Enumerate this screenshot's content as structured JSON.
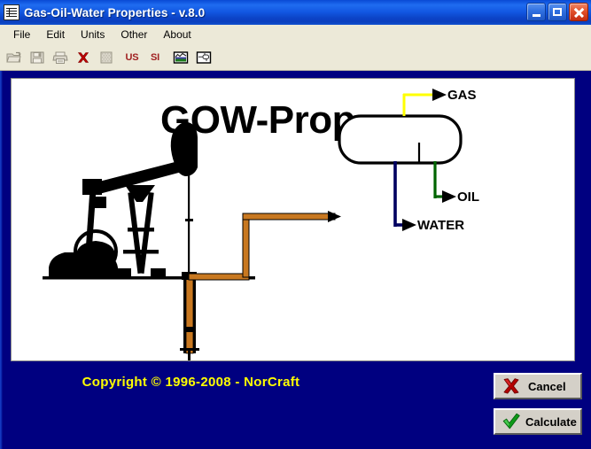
{
  "window": {
    "title": "Gas-Oil-Water Properties -  v.8.0",
    "icon": "document-lines-icon",
    "minimize_label": "",
    "maximize_label": "",
    "close_label": ""
  },
  "menu": {
    "items": [
      {
        "label": "File"
      },
      {
        "label": "Edit"
      },
      {
        "label": "Units"
      },
      {
        "label": "Other"
      },
      {
        "label": "About"
      }
    ]
  },
  "toolbar": {
    "buttons": [
      {
        "name": "open-button",
        "icon": "folder-open-icon",
        "label": ""
      },
      {
        "name": "save-button",
        "icon": "floppy-disk-icon",
        "label": ""
      },
      {
        "name": "print-button",
        "icon": "printer-icon",
        "label": ""
      },
      {
        "name": "delete-button",
        "icon": "red-x-icon",
        "label": ""
      },
      {
        "name": "new-button",
        "icon": "blank-page-icon",
        "label": ""
      },
      {
        "name": "us-units-button",
        "icon": "text-icon",
        "label": "US"
      },
      {
        "name": "si-units-button",
        "icon": "text-icon",
        "label": "SI"
      },
      {
        "name": "chart-button",
        "icon": "chart-image-icon",
        "label": ""
      },
      {
        "name": "diagram-button",
        "icon": "diagram-icon",
        "label": ""
      }
    ]
  },
  "main": {
    "app_title": "GOW-Prop",
    "diagram": {
      "pumpjack_label": "oil-pumpjack",
      "separator_label": "horizontal-separator-vessel",
      "streams": [
        {
          "name": "gas",
          "label": "GAS",
          "color": "#ffff00"
        },
        {
          "name": "oil",
          "label": "OIL",
          "color": "#006400"
        },
        {
          "name": "water",
          "label": "WATER",
          "color": "#000060"
        },
        {
          "name": "inlet",
          "label": "",
          "color": "#c87820"
        }
      ]
    }
  },
  "footer": {
    "copyright": "Copyright © 1996-2008 - NorCraft"
  },
  "buttons": {
    "cancel": {
      "label": "Cancel",
      "icon": "red-x-icon"
    },
    "calculate": {
      "label": "Calculate",
      "icon": "green-check-icon"
    }
  },
  "colors": {
    "titlebar": "#1157e0",
    "client_bg": "#000080",
    "panel_bg": "#ffffff",
    "menubar_bg": "#ece9d8",
    "copyright_text": "#ffff00",
    "button_face": "#d4d0c8",
    "gas": "#ffff00",
    "oil": "#006400",
    "water": "#000060",
    "inlet_pipe": "#c87820"
  }
}
